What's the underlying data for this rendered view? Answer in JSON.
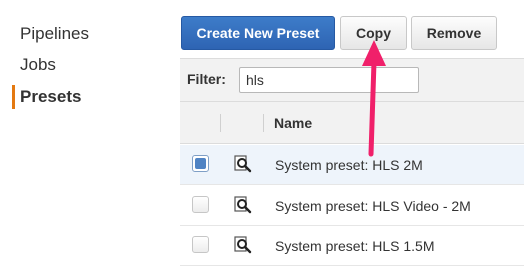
{
  "sidebar": {
    "items": [
      {
        "label": "Pipelines"
      },
      {
        "label": "Jobs"
      },
      {
        "label": "Presets"
      }
    ]
  },
  "toolbar": {
    "create_label": "Create New Preset",
    "copy_label": "Copy",
    "remove_label": "Remove"
  },
  "filter": {
    "label": "Filter:",
    "value": "hls"
  },
  "table": {
    "columns": [
      "Name"
    ],
    "rows": [
      {
        "name": "System preset: HLS 2M",
        "selected": true
      },
      {
        "name": "System preset: HLS Video - 2M",
        "selected": false
      },
      {
        "name": "System preset: HLS 1.5M",
        "selected": false
      }
    ]
  },
  "colors": {
    "accent": "#e47911",
    "primary_button": "#2e64b3",
    "annotation_arrow": "#f0206a",
    "selected_row": "#eef4fb"
  },
  "icons": {
    "row_action": "magnifier-icon",
    "annotation": "arrow-up-icon"
  }
}
